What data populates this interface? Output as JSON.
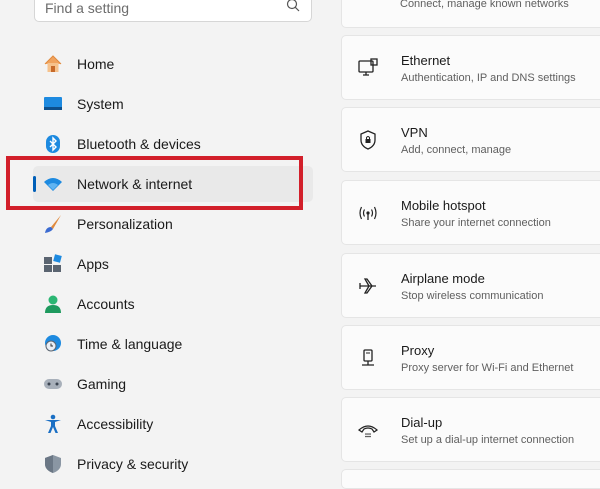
{
  "search": {
    "placeholder": "Find a setting"
  },
  "sidebar": {
    "items": [
      {
        "label": "Home",
        "icon": "home-icon"
      },
      {
        "label": "System",
        "icon": "system-icon"
      },
      {
        "label": "Bluetooth & devices",
        "icon": "bluetooth-icon"
      },
      {
        "label": "Network & internet",
        "icon": "network-wifi-icon",
        "selected": true
      },
      {
        "label": "Personalization",
        "icon": "brush-icon"
      },
      {
        "label": "Apps",
        "icon": "apps-icon"
      },
      {
        "label": "Accounts",
        "icon": "person-icon"
      },
      {
        "label": "Time & language",
        "icon": "clock-globe-icon"
      },
      {
        "label": "Gaming",
        "icon": "gamepad-icon"
      },
      {
        "label": "Accessibility",
        "icon": "accessibility-icon"
      },
      {
        "label": "Privacy & security",
        "icon": "shield-icon"
      }
    ]
  },
  "main": {
    "top_card_subtitle": "Connect, manage known networks",
    "cards": [
      {
        "title": "Ethernet",
        "subtitle": "Authentication, IP and DNS settings",
        "icon": "ethernet-icon"
      },
      {
        "title": "VPN",
        "subtitle": "Add, connect, manage",
        "icon": "vpn-shield-icon"
      },
      {
        "title": "Mobile hotspot",
        "subtitle": "Share your internet connection",
        "icon": "hotspot-icon"
      },
      {
        "title": "Airplane mode",
        "subtitle": "Stop wireless communication",
        "icon": "airplane-icon"
      },
      {
        "title": "Proxy",
        "subtitle": "Proxy server for Wi-Fi and Ethernet",
        "icon": "proxy-icon"
      },
      {
        "title": "Dial-up",
        "subtitle": "Set up a dial-up internet connection",
        "icon": "dialup-icon"
      }
    ]
  },
  "colors": {
    "accent": "#005fb8",
    "highlight": "#d21f2a"
  }
}
